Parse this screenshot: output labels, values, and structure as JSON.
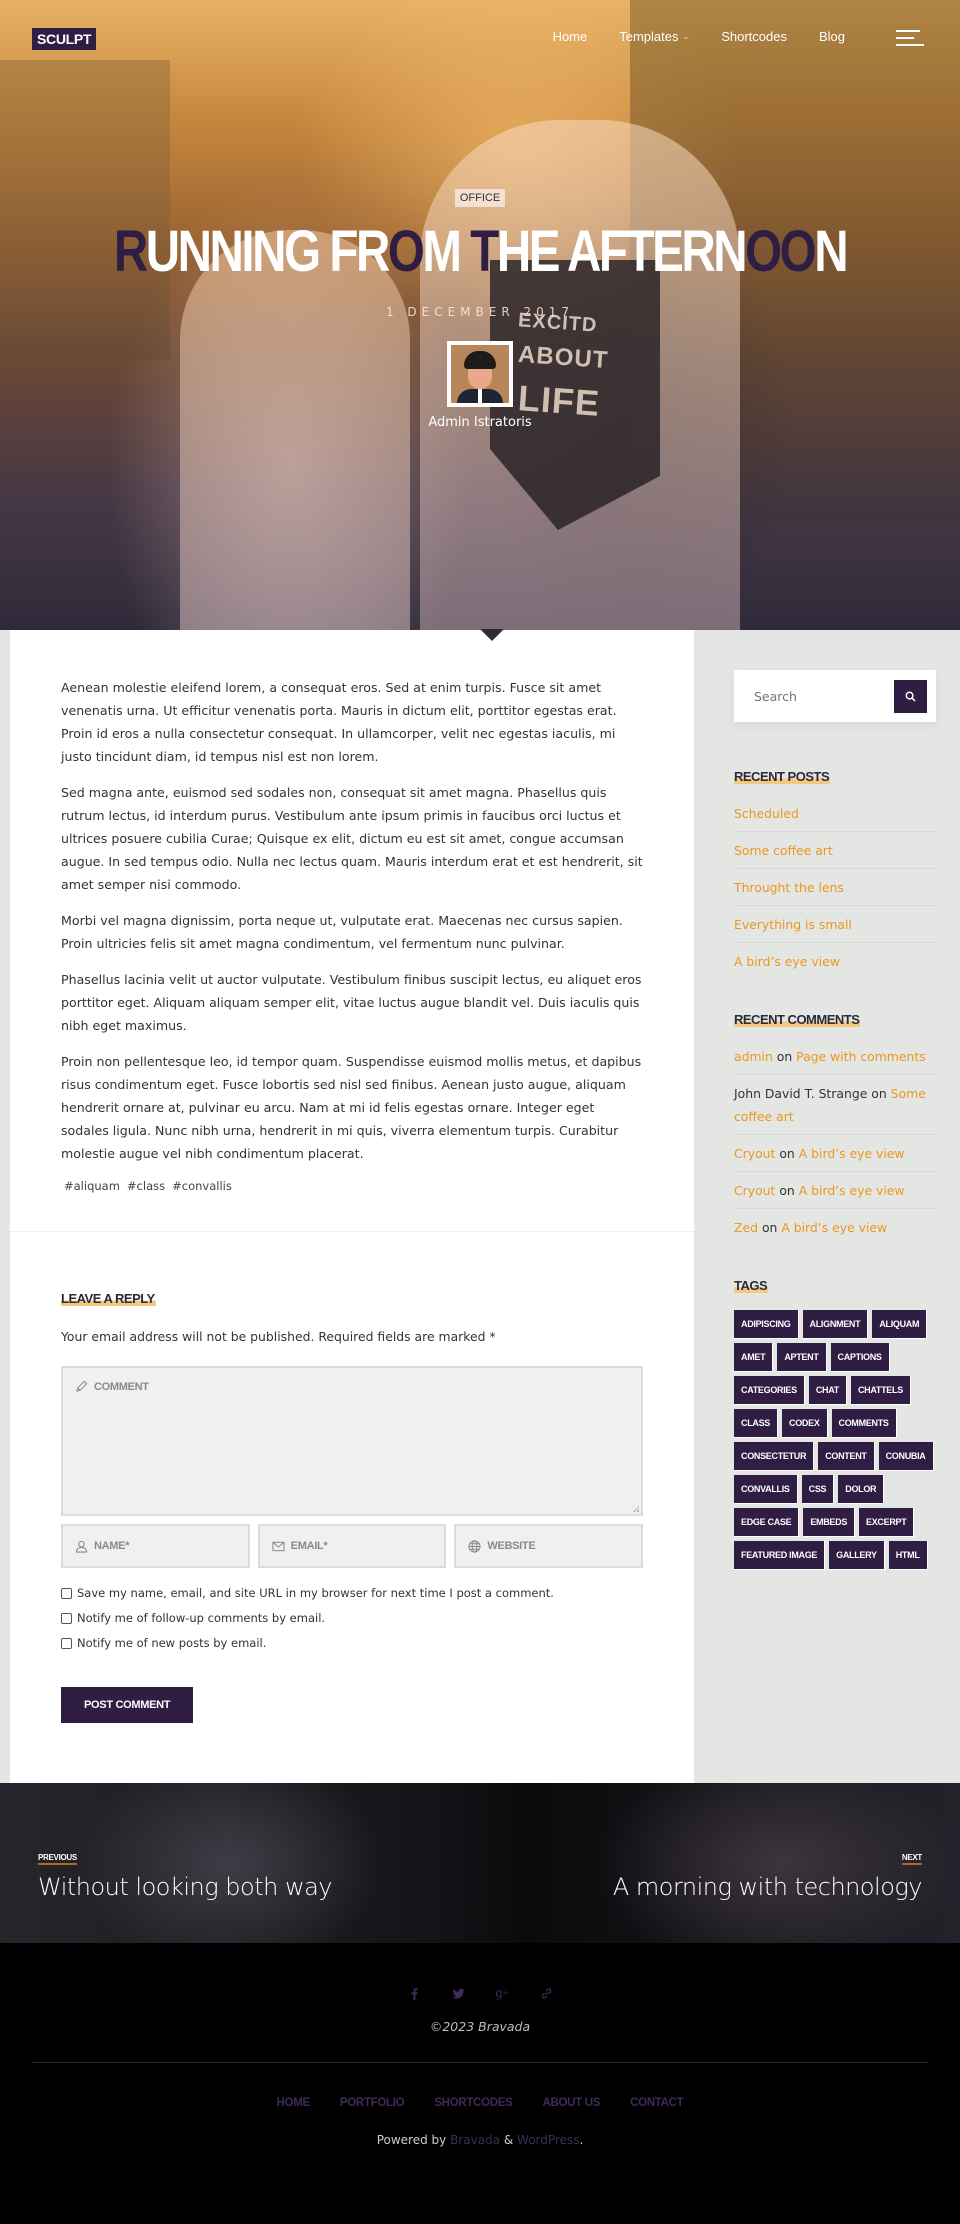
{
  "header": {
    "logo": "SCULPT",
    "nav": [
      {
        "label": "Home",
        "has_dropdown": false
      },
      {
        "label": "Templates",
        "has_dropdown": true,
        "dropdown_icon": "chevron-down-icon"
      },
      {
        "label": "Shortcodes",
        "has_dropdown": false
      },
      {
        "label": "Blog",
        "has_dropdown": false
      }
    ],
    "menu_icon": "hamburger-icon"
  },
  "hero": {
    "category": "OFFICE",
    "title_parts": [
      {
        "text": "R",
        "highlight": true
      },
      {
        "text": "UNNING FR",
        "highlight": false
      },
      {
        "text": "O",
        "highlight": true
      },
      {
        "text": "M ",
        "highlight": false
      },
      {
        "text": "T",
        "highlight": true
      },
      {
        "text": "HE AFTERN",
        "highlight": false
      },
      {
        "text": "OO",
        "highlight": true
      },
      {
        "text": "N",
        "highlight": false
      }
    ],
    "date": "1 DECEMBER 2017",
    "author": "Admin Istratoris",
    "shirt_text": [
      "EXCITD",
      "ABOUT",
      "LIFE"
    ]
  },
  "article": {
    "paragraphs": [
      "Aenean molestie eleifend lorem, a consequat eros. Sed at enim turpis. Fusce sit amet venenatis urna. Ut efficitur venenatis porta. Mauris in dictum elit, porttitor egestas erat. Proin id eros a nulla consectetur consequat. In ullamcorper, velit nec egestas iaculis, mi justo tincidunt diam, id tempus nisl est non lorem.",
      "Sed magna ante, euismod sed sodales non, consequat sit amet magna. Phasellus quis rutrum lectus, id interdum purus. Vestibulum ante ipsum primis in faucibus orci luctus et ultrices posuere cubilia Curae; Quisque ex elit, dictum eu est sit amet, congue accumsan augue. In sed tempus odio. Nulla nec lectus quam. Mauris interdum erat et est hendrerit, sit amet semper nisi commodo.",
      "Morbi vel magna dignissim, porta neque ut, vulputate erat. Maecenas nec cursus sapien. Proin ultricies felis sit amet magna condimentum, vel fermentum nunc pulvinar.",
      "Phasellus lacinia velit ut auctor vulputate. Vestibulum finibus suscipit lectus, eu aliquet eros porttitor eget. Aliquam aliquam semper elit, vitae luctus augue blandit vel. Duis iaculis quis nibh eget maximus.",
      "Proin non pellentesque leo, id tempor quam. Suspendisse euismod mollis metus, et dapibus risus condimentum eget. Fusce lobortis sed nisl sed finibus. Aenean justo augue, aliquam hendrerit ornare at, pulvinar eu arcu. Nam at mi id felis egestas ornare. Integer eget sodales ligula. Nunc nibh urna, hendrerit in mi quis, viverra elementum turpis. Curabitur molestie augue vel nibh condimentum placerat."
    ],
    "tags": [
      "#aliquam",
      "#class",
      "#convallis"
    ]
  },
  "reply": {
    "title": "LEAVE A REPLY",
    "note": "Your email address will not be published. Required fields are marked *",
    "comment_placeholder": "COMMENT",
    "name_placeholder": "NAME*",
    "email_placeholder": "EMAIL*",
    "website_placeholder": "WEBSITE",
    "checkboxes": [
      {
        "label": "Save my name, email, and site URL in my browser for next time I post a comment.",
        "checked": false
      },
      {
        "label": "Notify me of follow-up comments by email.",
        "checked": false
      },
      {
        "label": "Notify me of new posts by email.",
        "checked": false
      }
    ],
    "submit_label": "POST COMMENT"
  },
  "sidebar": {
    "search_placeholder": "Search",
    "recent_posts": {
      "title": "RECENT POSTS",
      "items": [
        "Scheduled",
        "Some coffee art",
        "Throught the lens",
        "Everything is small",
        "A bird’s eye view"
      ]
    },
    "recent_comments": {
      "title": "RECENT COMMENTS",
      "items": [
        {
          "author": "admin",
          "author_is_link": true,
          "on": "on",
          "post": "Page with comments"
        },
        {
          "author": "John David T. Strange",
          "author_is_link": false,
          "on": "on",
          "post": "Some coffee art"
        },
        {
          "author": "Cryout",
          "author_is_link": true,
          "on": "on",
          "post": "A bird’s eye view"
        },
        {
          "author": "Cryout",
          "author_is_link": true,
          "on": "on",
          "post": "A bird’s eye view"
        },
        {
          "author": "Zed",
          "author_is_link": true,
          "on": "on",
          "post": "A bird’s eye view"
        }
      ]
    },
    "tags": {
      "title": "TAGS",
      "items": [
        "ADIPISCING",
        "ALIGNMENT",
        "ALIQUAM",
        "AMET",
        "APTENT",
        "CAPTIONS",
        "CATEGORIES",
        "CHAT",
        "CHATTELS",
        "CLASS",
        "CODEX",
        "COMMENTS",
        "CONSECTETUR",
        "CONTENT",
        "CONUBIA",
        "CONVALLIS",
        "CSS",
        "DOLOR",
        "EDGE CASE",
        "EMBEDS",
        "EXCERPT",
        "FEATURED IMAGE",
        "GALLERY",
        "HTML"
      ]
    }
  },
  "post_nav": {
    "prev_kicker": "PREVIOUS",
    "prev_title": "Without looking both way",
    "next_kicker": "NEXT",
    "next_title": "A morning with technology"
  },
  "footer": {
    "socials": [
      "facebook-icon",
      "twitter-icon",
      "google-plus-icon",
      "link-icon"
    ],
    "copyright": "©2023 Bravada",
    "menu": [
      "HOME",
      "PORTFOLIO",
      "SHORTCODES",
      "ABOUT US",
      "CONTACT"
    ],
    "powered_prefix": "Powered by",
    "powered_theme": "Bravada",
    "powered_amp": "&",
    "powered_cms": "WordPress",
    "powered_suffix": "."
  },
  "colors": {
    "brand_purple": "#2f1d44",
    "link_orange": "#eb9722",
    "title_underline": "#f4c880",
    "sidebar_bg": "#e4e6e3",
    "footer_link": "#3f2b55"
  }
}
